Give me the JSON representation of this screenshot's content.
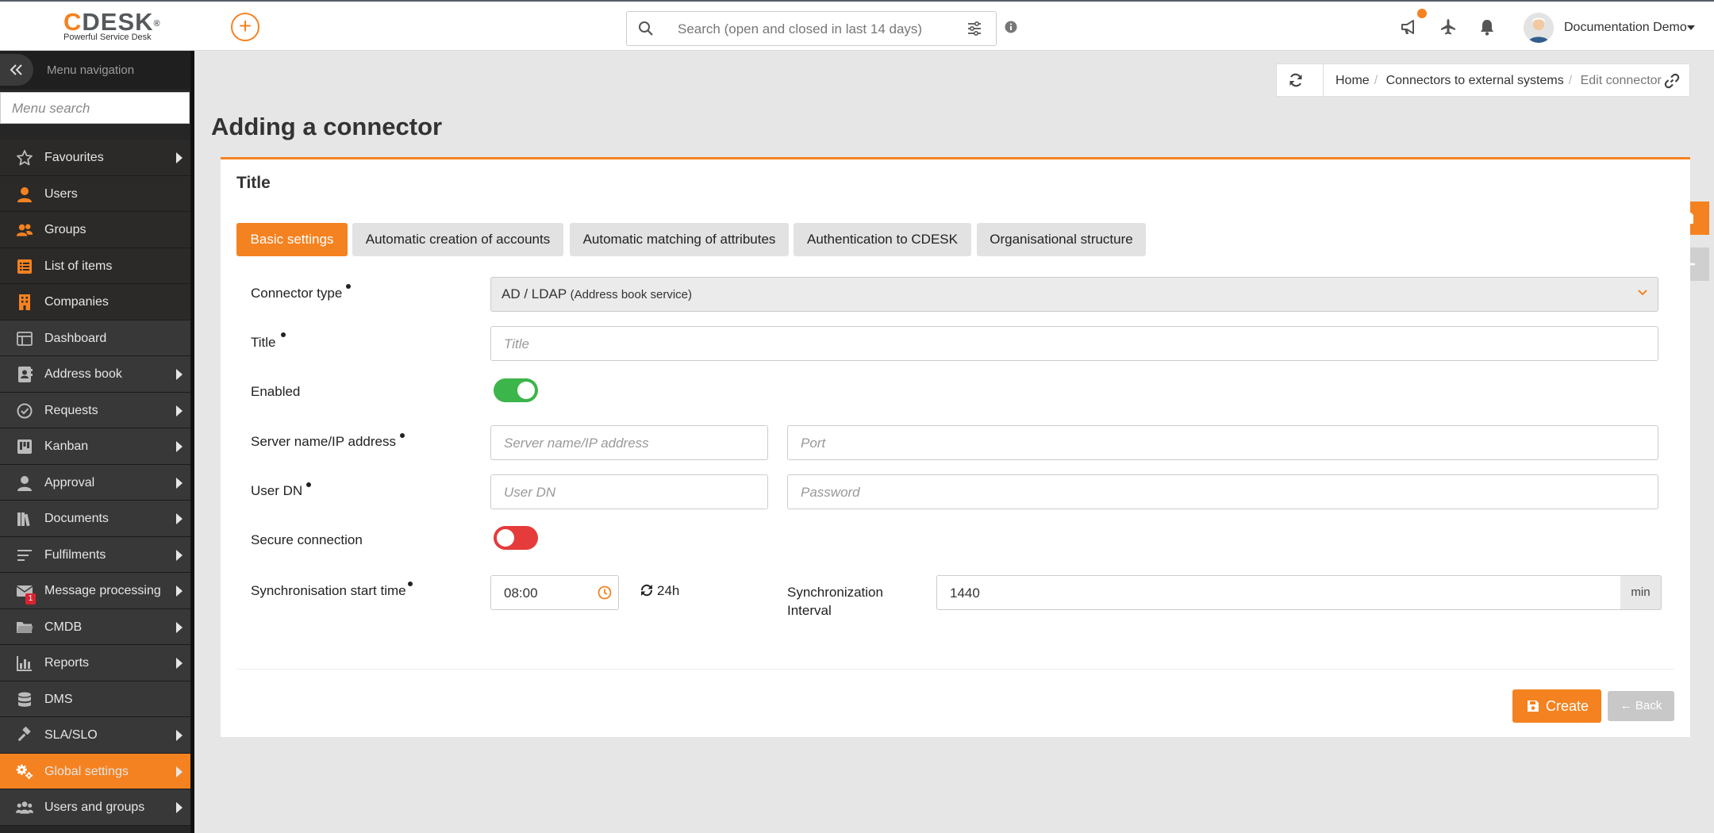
{
  "app": {
    "logo_text": "CDESK",
    "logo_tagline": "Powerful Service Desk",
    "search_placeholder": "Search (open and closed in last 14 days)",
    "user_name": "Documentation Demo",
    "accent_color": "#f58220"
  },
  "sidebar": {
    "header_label": "Menu navigation",
    "search_placeholder": "Menu search",
    "items": [
      {
        "label": "Favourites",
        "icon": "star-icon",
        "has_submenu": true
      },
      {
        "label": "Users",
        "icon": "user-icon",
        "has_submenu": false
      },
      {
        "label": "Groups",
        "icon": "users-icon",
        "has_submenu": false
      },
      {
        "label": "List of items",
        "icon": "list-icon",
        "has_submenu": false
      },
      {
        "label": "Companies",
        "icon": "building-icon",
        "has_submenu": false
      },
      {
        "label": "Dashboard",
        "icon": "dashboard-icon",
        "has_submenu": false
      },
      {
        "label": "Address book",
        "icon": "address-book-icon",
        "has_submenu": true
      },
      {
        "label": "Requests",
        "icon": "requests-icon",
        "has_submenu": true
      },
      {
        "label": "Kanban",
        "icon": "kanban-icon",
        "has_submenu": true
      },
      {
        "label": "Approval",
        "icon": "approval-icon",
        "has_submenu": true
      },
      {
        "label": "Documents",
        "icon": "documents-icon",
        "has_submenu": true
      },
      {
        "label": "Fulfilments",
        "icon": "fulfilments-icon",
        "has_submenu": true
      },
      {
        "label": "Message processing",
        "icon": "envelope-icon",
        "has_submenu": true,
        "badge": "1"
      },
      {
        "label": "CMDB",
        "icon": "folder-icon",
        "has_submenu": true
      },
      {
        "label": "Reports",
        "icon": "chart-icon",
        "has_submenu": true
      },
      {
        "label": "DMS",
        "icon": "database-icon",
        "has_submenu": false
      },
      {
        "label": "SLA/SLO",
        "icon": "gavel-icon",
        "has_submenu": true
      },
      {
        "label": "Global settings",
        "icon": "cogs-icon",
        "has_submenu": true,
        "active": true
      },
      {
        "label": "Users and groups",
        "icon": "users-groups-icon",
        "has_submenu": true
      }
    ]
  },
  "breadcrumb": {
    "items": [
      "Home",
      "Connectors to external systems"
    ],
    "current": "Edit connector"
  },
  "page": {
    "title": "Adding a connector",
    "panel_title": "Title"
  },
  "tabs": [
    {
      "label": "Basic settings",
      "active": true
    },
    {
      "label": "Automatic creation of accounts",
      "active": false
    },
    {
      "label": "Automatic matching of attributes",
      "active": false
    },
    {
      "label": "Authentication to CDESK",
      "active": false
    },
    {
      "label": "Organisational structure",
      "active": false
    }
  ],
  "form": {
    "connector_type": {
      "label": "Connector type",
      "value": "AD / LDAP",
      "value_note": "(Address book service)"
    },
    "title": {
      "label": "Title",
      "placeholder": "Title"
    },
    "enabled": {
      "label": "Enabled",
      "value": true
    },
    "server": {
      "label": "Server name/IP address",
      "placeholder": "Server name/IP address",
      "port_placeholder": "Port"
    },
    "user_dn": {
      "label": "User DN",
      "placeholder": "User DN",
      "password_placeholder": "Password"
    },
    "secure": {
      "label": "Secure connection",
      "value": false
    },
    "sync_start": {
      "label": "Synchronisation start time",
      "value": "08:00",
      "cycle": "24h"
    },
    "sync_interval": {
      "label_line1": "Synchronization",
      "label_line2": "Interval",
      "value": "1440",
      "unit": "min"
    }
  },
  "buttons": {
    "create": "Create",
    "back": "Back"
  }
}
